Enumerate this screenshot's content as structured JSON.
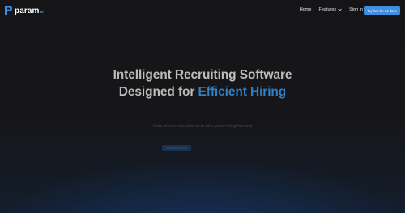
{
  "brand": {
    "name": "param",
    "suffix": "ai"
  },
  "nav": {
    "home": "Home",
    "features": "Features",
    "signin": "Sign in",
    "cta": "Try free for 14 days"
  },
  "hero": {
    "title_line1": "Intelligent Recruiting Software",
    "title_line2_prefix": "Designed for ",
    "title_line2_accent": "Efficient Hiring",
    "subtitle": "Data-driven recruitment to take your hiring forward",
    "button_label": "Schedule a demo"
  },
  "colors": {
    "accent": "#3f8ee0",
    "title_accent": "#2f7fc9",
    "background": "#141416"
  }
}
